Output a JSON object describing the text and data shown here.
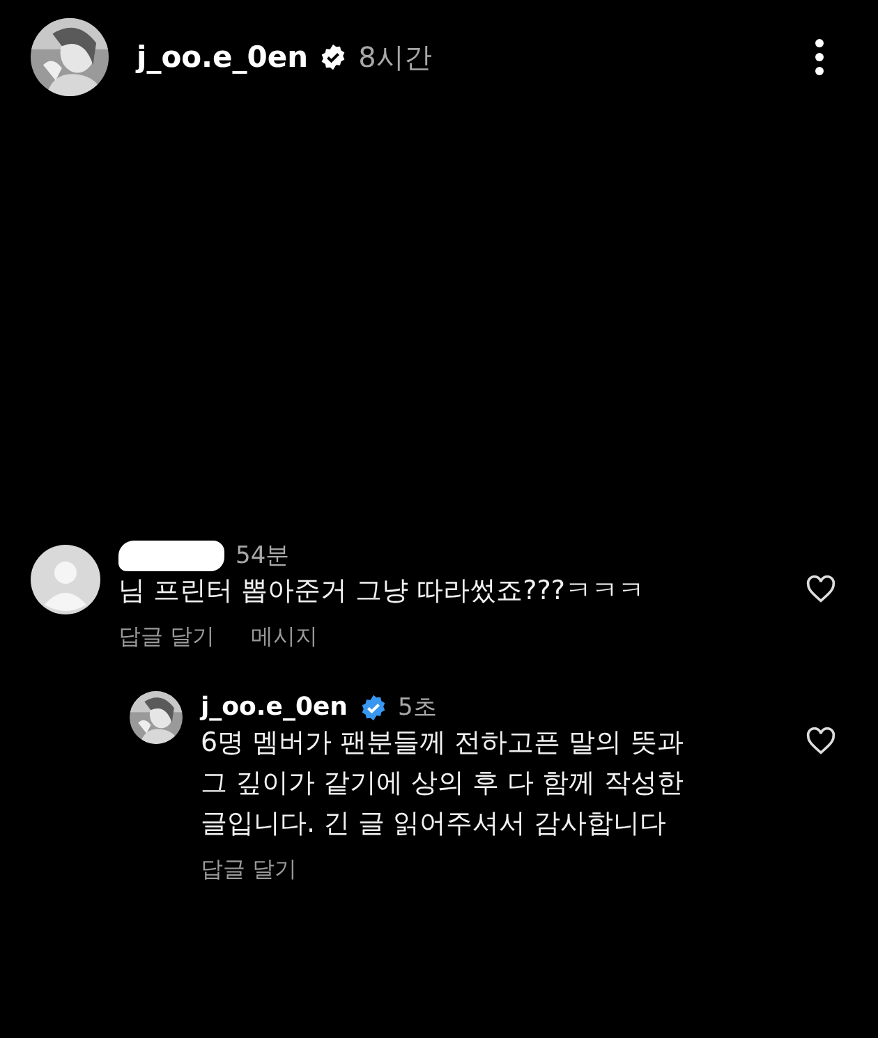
{
  "post_header": {
    "username": "j_oo.e_0en",
    "verified": true,
    "time": "8시간",
    "avatar": {
      "kind": "picture"
    }
  },
  "comments": [
    {
      "username_redacted": true,
      "avatar": {
        "kind": "placeholder"
      },
      "time": "54분",
      "text": "님 프린터 뽑아준거 그냥 따라썼죠???ㅋㅋㅋ",
      "actions": [
        "답글 달기",
        "메시지"
      ],
      "liked": false,
      "replies": [
        {
          "username": "j_oo.e_0en",
          "verified": true,
          "avatar": {
            "kind": "picture"
          },
          "time": "5초",
          "text": "6명 멤버가 팬분들께 전하고픈 말의 뜻과 그 깊이가 같기에 상의 후 다 함께 작성한 글입니다. 긴 글 읽어주셔서 감사합니다",
          "actions": [
            "답글 달기"
          ],
          "liked": false
        }
      ]
    }
  ]
}
